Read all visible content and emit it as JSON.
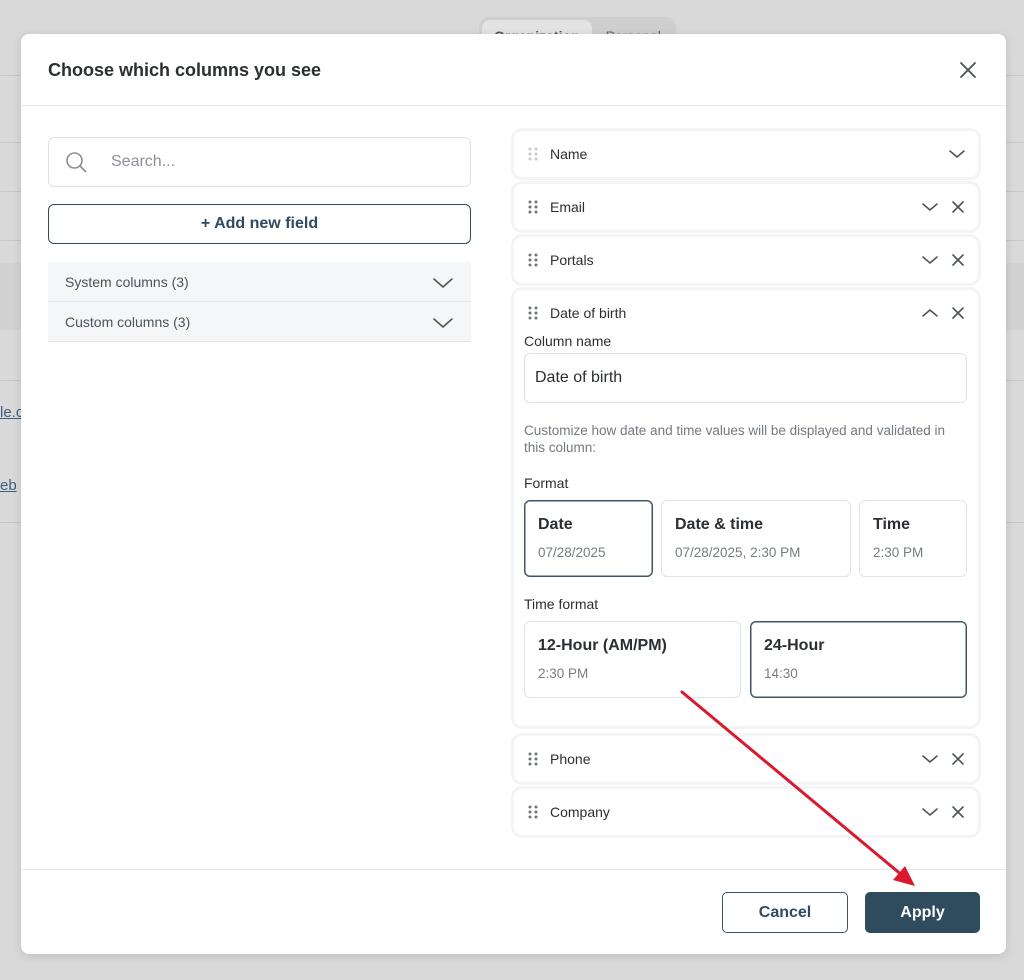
{
  "background": {
    "tabs": [
      "Organization",
      "Personal"
    ],
    "links": [
      "le.c",
      "eb"
    ]
  },
  "modal": {
    "title": "Choose which columns you see",
    "close_icon": "close-icon"
  },
  "left_panel": {
    "search": {
      "placeholder": "Search...",
      "value": ""
    },
    "add_field_label": "+ Add new field",
    "groups": [
      {
        "label": "System columns (3)"
      },
      {
        "label": "Custom columns (3)"
      }
    ]
  },
  "columns": [
    {
      "name": "Name",
      "removable": false,
      "expanded": false
    },
    {
      "name": "Email",
      "removable": true,
      "expanded": false
    },
    {
      "name": "Portals",
      "removable": true,
      "expanded": false
    },
    {
      "name": "Date of birth",
      "removable": true,
      "expanded": true
    },
    {
      "name": "Phone",
      "removable": true,
      "expanded": false
    },
    {
      "name": "Company",
      "removable": true,
      "expanded": false
    }
  ],
  "date_settings": {
    "column_name_label": "Column name",
    "column_name_value": "Date of birth",
    "help_text": "Customize how date and time values will be displayed and validated in this column:",
    "format_label": "Format",
    "formats": [
      {
        "title": "Date",
        "example": "07/28/2025",
        "selected": true
      },
      {
        "title": "Date & time",
        "example": "07/28/2025, 2:30 PM",
        "selected": false
      },
      {
        "title": "Time",
        "example": "2:30 PM",
        "selected": false
      }
    ],
    "time_format_label": "Time format",
    "time_formats": [
      {
        "title": "12-Hour (AM/PM)",
        "example": "2:30 PM",
        "selected": false
      },
      {
        "title": "24-Hour",
        "example": "14:30",
        "selected": true
      }
    ]
  },
  "footer": {
    "cancel_label": "Cancel",
    "apply_label": "Apply"
  },
  "colors": {
    "primary": "#2f4b5e",
    "annotation_arrow": "#d9192e"
  }
}
